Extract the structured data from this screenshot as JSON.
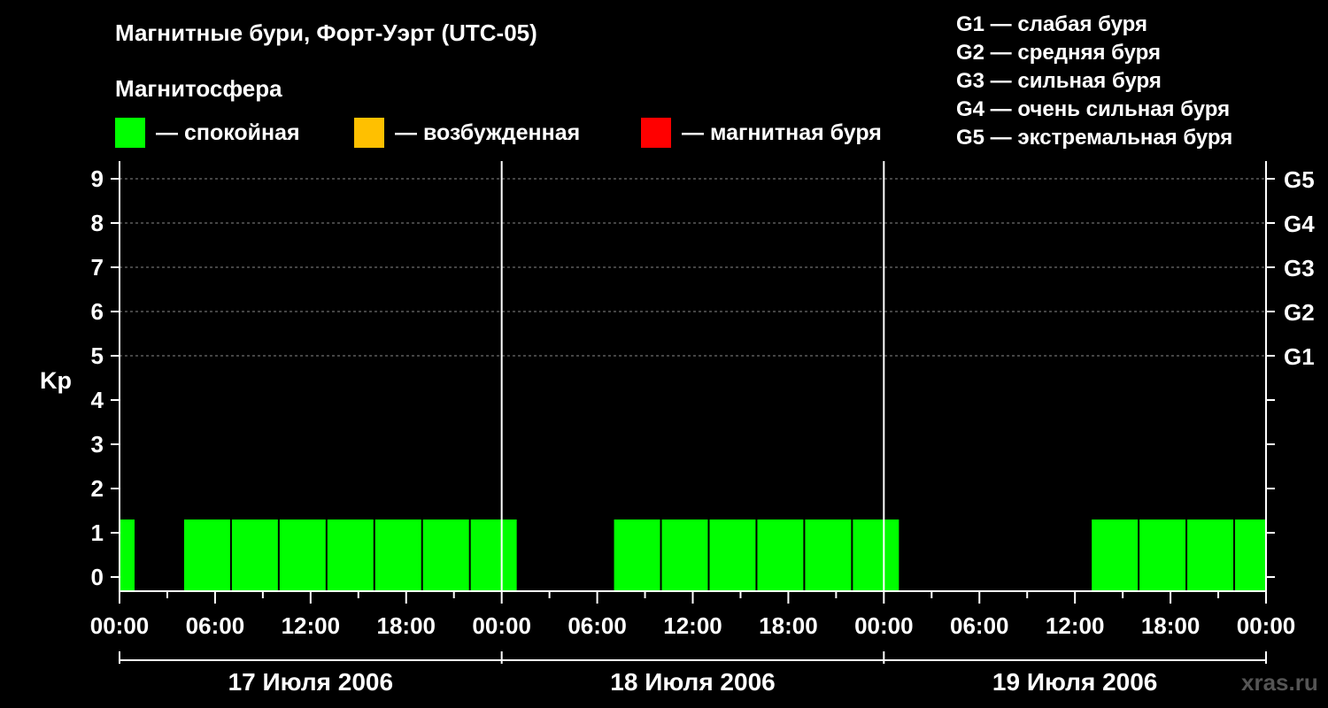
{
  "title": "Магнитные бури, Форт-Уэрт (UTC-05)",
  "subtitle": "Магнитосфера",
  "legend": [
    {
      "label": "— спокойная",
      "color": "#00ff00"
    },
    {
      "label": "— возбужденная",
      "color": "#ffc000"
    },
    {
      "label": "— магнитная буря",
      "color": "#ff0000"
    }
  ],
  "g_scale": [
    "G1 — слабая буря",
    "G2 — средняя буря",
    "G3 — сильная буря",
    "G4 — очень сильная буря",
    "G5 — экстремальная буря"
  ],
  "watermark": "xras.ru",
  "chart_data": {
    "type": "bar",
    "ylabel": "Kp",
    "ylim": [
      0,
      9
    ],
    "yticks": [
      "0",
      "1",
      "2",
      "3",
      "4",
      "5",
      "6",
      "7",
      "8",
      "9"
    ],
    "right_ticks": [
      {
        "y": 5,
        "label": "G1"
      },
      {
        "y": 6,
        "label": "G2"
      },
      {
        "y": 7,
        "label": "G3"
      },
      {
        "y": 8,
        "label": "G4"
      },
      {
        "y": 9,
        "label": "G5"
      }
    ],
    "xlim_hours": [
      0,
      72
    ],
    "x_tick_labels": [
      "00:00",
      "06:00",
      "12:00",
      "18:00",
      "00:00",
      "06:00",
      "12:00",
      "18:00",
      "00:00",
      "06:00",
      "12:00",
      "18:00",
      "00:00"
    ],
    "days": [
      "17 Июля 2006",
      "18 Июля 2006",
      "19 Июля 2006"
    ],
    "grid": true,
    "colors": {
      "quiet": "#00ff00",
      "active": "#ffc000",
      "storm": "#ff0000"
    },
    "bars": [
      {
        "start": 0,
        "end": 1,
        "kp": 1,
        "state": "quiet"
      },
      {
        "start": 4,
        "end": 7,
        "kp": 1,
        "state": "quiet"
      },
      {
        "start": 7,
        "end": 10,
        "kp": 1,
        "state": "quiet"
      },
      {
        "start": 10,
        "end": 13,
        "kp": 1,
        "state": "quiet"
      },
      {
        "start": 13,
        "end": 16,
        "kp": 1,
        "state": "quiet"
      },
      {
        "start": 16,
        "end": 19,
        "kp": 1,
        "state": "quiet"
      },
      {
        "start": 19,
        "end": 22,
        "kp": 1,
        "state": "quiet"
      },
      {
        "start": 22,
        "end": 25,
        "kp": 1,
        "state": "quiet"
      },
      {
        "start": 31,
        "end": 34,
        "kp": 1,
        "state": "quiet"
      },
      {
        "start": 34,
        "end": 37,
        "kp": 1,
        "state": "quiet"
      },
      {
        "start": 37,
        "end": 40,
        "kp": 1,
        "state": "quiet"
      },
      {
        "start": 40,
        "end": 43,
        "kp": 1,
        "state": "quiet"
      },
      {
        "start": 43,
        "end": 46,
        "kp": 1,
        "state": "quiet"
      },
      {
        "start": 46,
        "end": 49,
        "kp": 1,
        "state": "quiet"
      },
      {
        "start": 61,
        "end": 64,
        "kp": 1,
        "state": "quiet"
      },
      {
        "start": 64,
        "end": 67,
        "kp": 1,
        "state": "quiet"
      },
      {
        "start": 67,
        "end": 70,
        "kp": 1,
        "state": "quiet"
      },
      {
        "start": 70,
        "end": 72,
        "kp": 1,
        "state": "quiet"
      }
    ]
  }
}
